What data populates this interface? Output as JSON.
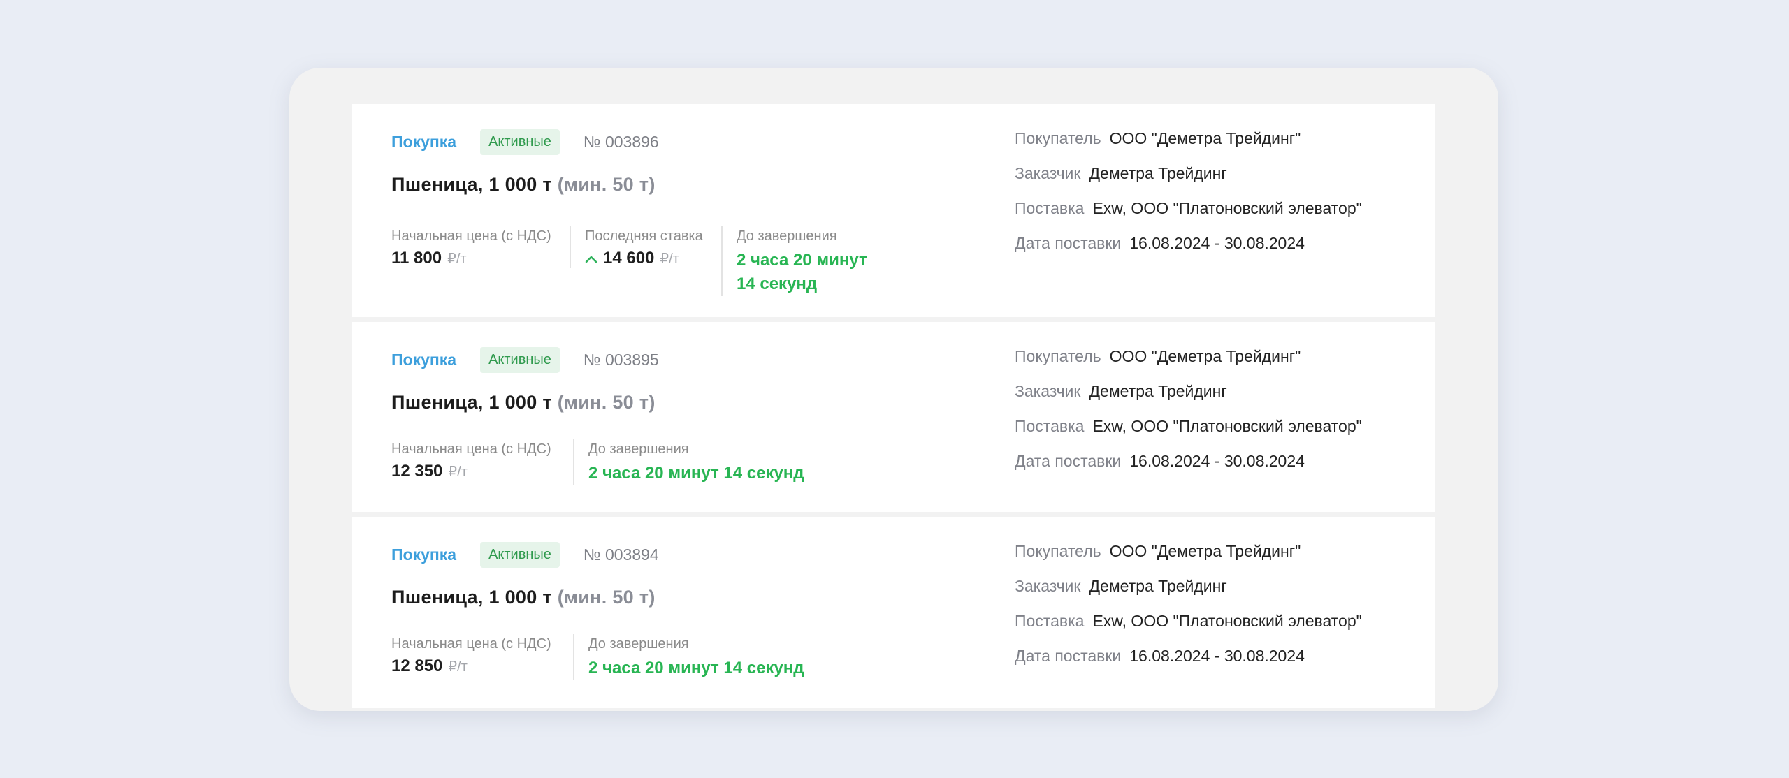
{
  "cards": [
    {
      "type": "Покупка",
      "status": "Активные",
      "number": "№ 003896",
      "title": "Пшеница, 1 000 т",
      "min": "(мин. 50 т)",
      "start_price_label": "Начальная цена (с НДС)",
      "start_price": "11 800",
      "unit": "₽/т",
      "last_bid_label": "Последняя ставка",
      "last_bid": "14 600",
      "timer_label": "До завершения",
      "timer": "2 часа 20 минут 14 секунд",
      "buyer_label": "Покупатель",
      "buyer": "ООО \"Деметра Трейдинг\"",
      "customer_label": "Заказчик",
      "customer": "Деметра Трейдинг",
      "delivery_label": "Поставка",
      "delivery": "Exw, ООО \"Платоновский элеватор\"",
      "date_label": "Дата поставки",
      "date": "16.08.2024 - 30.08.2024"
    },
    {
      "type": "Покупка",
      "status": "Активные",
      "number": "№ 003895",
      "title": "Пшеница, 1 000 т",
      "min": "(мин. 50 т)",
      "start_price_label": "Начальная цена (с НДС)",
      "start_price": "12 350",
      "unit": "₽/т",
      "timer_label": "До завершения",
      "timer": "2 часа 20 минут 14 секунд",
      "buyer_label": "Покупатель",
      "buyer": "ООО \"Деметра Трейдинг\"",
      "customer_label": "Заказчик",
      "customer": "Деметра Трейдинг",
      "delivery_label": "Поставка",
      "delivery": "Exw, ООО \"Платоновский элеватор\"",
      "date_label": "Дата поставки",
      "date": "16.08.2024 - 30.08.2024"
    },
    {
      "type": "Покупка",
      "status": "Активные",
      "number": "№ 003894",
      "title": "Пшеница, 1 000 т",
      "min": "(мин. 50 т)",
      "start_price_label": "Начальная цена (с НДС)",
      "start_price": "12 850",
      "unit": "₽/т",
      "timer_label": "До завершения",
      "timer": "2 часа 20 минут 14 секунд",
      "buyer_label": "Покупатель",
      "buyer": "ООО \"Деметра Трейдинг\"",
      "customer_label": "Заказчик",
      "customer": "Деметра Трейдинг",
      "delivery_label": "Поставка",
      "delivery": "Exw, ООО \"Платоновский элеватор\"",
      "date_label": "Дата поставки",
      "date": "16.08.2024 - 30.08.2024"
    }
  ],
  "colors": {
    "type": "#3d9fdc",
    "badge_bg": "#e6f4ea",
    "badge_text": "#2f9a4d",
    "timer": "#28b553"
  },
  "icons": {
    "bid_trend": "chevron-up-icon"
  }
}
